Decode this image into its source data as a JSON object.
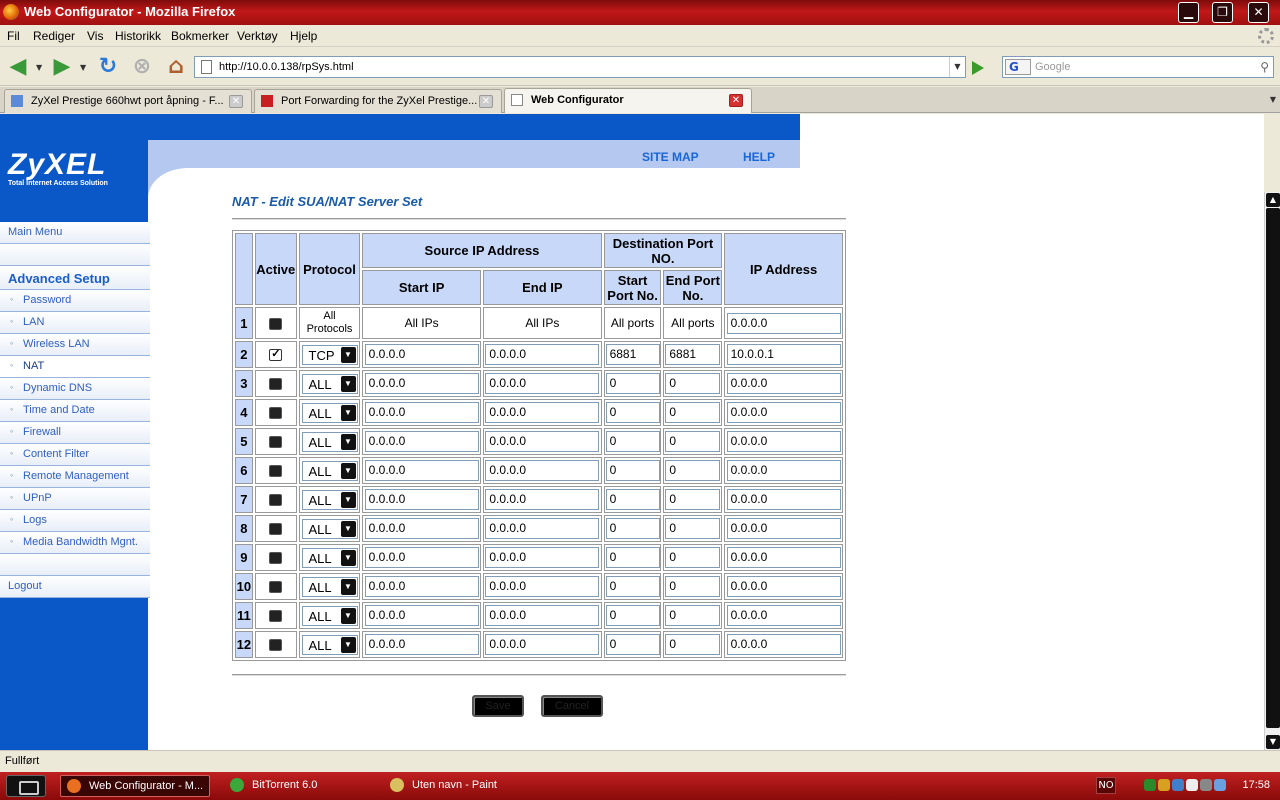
{
  "window": {
    "title": "Web Configurator - Mozilla Firefox",
    "minimize": "▁",
    "restore": "❐",
    "close": "✕"
  },
  "menubar": [
    "Fil",
    "Rediger",
    "Vis",
    "Historikk",
    "Bokmerker",
    "Verktøy",
    "Hjelp"
  ],
  "navigation": {
    "url": "http://10.0.0.138/rpSys.html",
    "search_placeholder": "Google",
    "search_engine": "G"
  },
  "tabs": [
    {
      "label": "ZyXel Prestige 660hwt port åpning - F...",
      "active": false
    },
    {
      "label": "Port Forwarding for the ZyXel Prestige...",
      "active": false
    },
    {
      "label": "Web Configurator",
      "active": true
    }
  ],
  "header": {
    "logo": "ZyXEL",
    "logo_tagline": "Total Internet Access Solution",
    "site_map": "SITE MAP",
    "help": "HELP"
  },
  "sidebar": {
    "main_menu": "Main Menu",
    "advanced_setup": "Advanced Setup",
    "items": [
      "Password",
      "LAN",
      "Wireless LAN",
      "NAT",
      "Dynamic DNS",
      "Time and Date",
      "Firewall",
      "Content Filter",
      "Remote Management",
      "UPnP",
      "Logs",
      "Media Bandwidth Mgnt."
    ],
    "active_item": "NAT",
    "logout": "Logout"
  },
  "page": {
    "title": "NAT - Edit SUA/NAT Server Set",
    "headers": {
      "active": "Active",
      "protocol": "Protocol",
      "source_ip": "Source IP Address",
      "dest_port": "Destination Port NO.",
      "ip_address": "IP Address",
      "start_ip": "Start IP",
      "end_ip": "End IP",
      "start_port": "Start Port No.",
      "end_port": "End Port No."
    },
    "row1": {
      "num": "1",
      "protocol": "All Protocols",
      "start_ip": "All IPs",
      "end_ip": "All IPs",
      "start_port": "All ports",
      "end_port": "All ports",
      "ip_address": "0.0.0.0"
    },
    "rows": [
      {
        "num": "2",
        "active": true,
        "protocol": "TCP",
        "start_ip": "0.0.0.0",
        "end_ip": "0.0.0.0",
        "start_port": "6881",
        "end_port": "6881",
        "ip_address": "10.0.0.1"
      },
      {
        "num": "3",
        "active": false,
        "protocol": "ALL",
        "start_ip": "0.0.0.0",
        "end_ip": "0.0.0.0",
        "start_port": "0",
        "end_port": "0",
        "ip_address": "0.0.0.0"
      },
      {
        "num": "4",
        "active": false,
        "protocol": "ALL",
        "start_ip": "0.0.0.0",
        "end_ip": "0.0.0.0",
        "start_port": "0",
        "end_port": "0",
        "ip_address": "0.0.0.0"
      },
      {
        "num": "5",
        "active": false,
        "protocol": "ALL",
        "start_ip": "0.0.0.0",
        "end_ip": "0.0.0.0",
        "start_port": "0",
        "end_port": "0",
        "ip_address": "0.0.0.0"
      },
      {
        "num": "6",
        "active": false,
        "protocol": "ALL",
        "start_ip": "0.0.0.0",
        "end_ip": "0.0.0.0",
        "start_port": "0",
        "end_port": "0",
        "ip_address": "0.0.0.0"
      },
      {
        "num": "7",
        "active": false,
        "protocol": "ALL",
        "start_ip": "0.0.0.0",
        "end_ip": "0.0.0.0",
        "start_port": "0",
        "end_port": "0",
        "ip_address": "0.0.0.0"
      },
      {
        "num": "8",
        "active": false,
        "protocol": "ALL",
        "start_ip": "0.0.0.0",
        "end_ip": "0.0.0.0",
        "start_port": "0",
        "end_port": "0",
        "ip_address": "0.0.0.0"
      },
      {
        "num": "9",
        "active": false,
        "protocol": "ALL",
        "start_ip": "0.0.0.0",
        "end_ip": "0.0.0.0",
        "start_port": "0",
        "end_port": "0",
        "ip_address": "0.0.0.0"
      },
      {
        "num": "10",
        "active": false,
        "protocol": "ALL",
        "start_ip": "0.0.0.0",
        "end_ip": "0.0.0.0",
        "start_port": "0",
        "end_port": "0",
        "ip_address": "0.0.0.0"
      },
      {
        "num": "11",
        "active": false,
        "protocol": "ALL",
        "start_ip": "0.0.0.0",
        "end_ip": "0.0.0.0",
        "start_port": "0",
        "end_port": "0",
        "ip_address": "0.0.0.0"
      },
      {
        "num": "12",
        "active": false,
        "protocol": "ALL",
        "start_ip": "0.0.0.0",
        "end_ip": "0.0.0.0",
        "start_port": "0",
        "end_port": "0",
        "ip_address": "0.0.0.0"
      }
    ],
    "save_button": "Save",
    "cancel_button": "Cancel"
  },
  "statusbar": {
    "text": "Fullført"
  },
  "taskbar": {
    "items": [
      {
        "label": "Web Configurator - M...",
        "active": true,
        "icon": "firefox-icon",
        "color": "#e87020"
      },
      {
        "label": "BitTorrent 6.0",
        "active": false,
        "icon": "bittorrent-icon",
        "color": "#3aa83a"
      },
      {
        "label": "Uten navn - Paint",
        "active": false,
        "icon": "paint-icon",
        "color": "#d8c060"
      }
    ],
    "language": "NO",
    "clock": "17:58"
  }
}
